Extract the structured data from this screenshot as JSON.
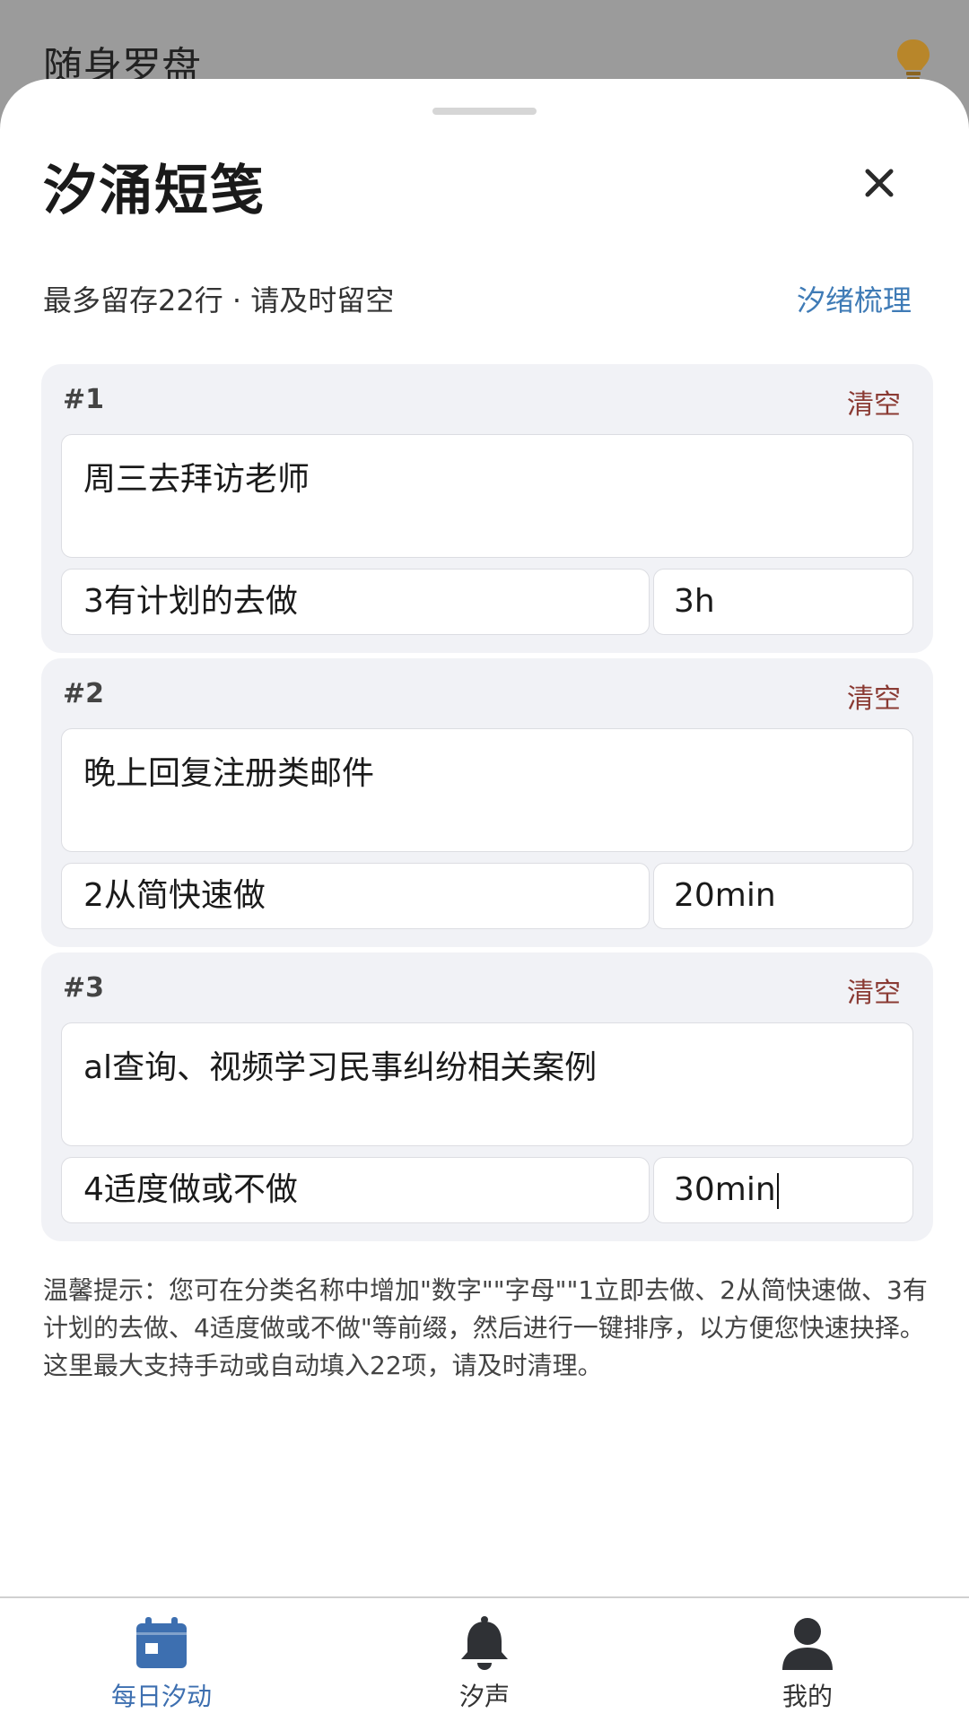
{
  "background": {
    "app_title": "随身罗盘"
  },
  "sheet": {
    "title": "汐涌短笺",
    "subtitle": "最多留存22行 · 请及时留空",
    "organize_link": "汐绪梳理"
  },
  "cards": [
    {
      "index": "#1",
      "clear_label": "清空",
      "text": "周三去拜访老师",
      "category": "3有计划的去做",
      "duration": "3h"
    },
    {
      "index": "#2",
      "clear_label": "清空",
      "text": "晚上回复注册类邮件",
      "category": "2从简快速做",
      "duration": "20min"
    },
    {
      "index": "#3",
      "clear_label": "清空",
      "text": "al查询、视频学习民事纠纷相关案例",
      "category": "4适度做或不做",
      "duration": "30min"
    }
  ],
  "tip": "温馨提示：您可在分类名称中增加\"数字\"\"字母\"\"1立即去做、2从简快速做、3有计划的去做、4适度做或不做\"等前缀，然后进行一键排序，以方便您快速抉择。这里最大支持手动或自动填入22项，请及时清理。",
  "nav": {
    "items": [
      {
        "label": "每日汐动",
        "icon": "calendar-icon",
        "active": true
      },
      {
        "label": "汐声",
        "icon": "bell-icon",
        "active": false
      },
      {
        "label": "我的",
        "icon": "person-icon",
        "active": false
      }
    ]
  },
  "colors": {
    "accent": "#3d6fb0",
    "link": "#3f7bb6",
    "danger": "#8a3a33",
    "card_bg": "#f1f2f6",
    "bulb": "#b8862a"
  }
}
